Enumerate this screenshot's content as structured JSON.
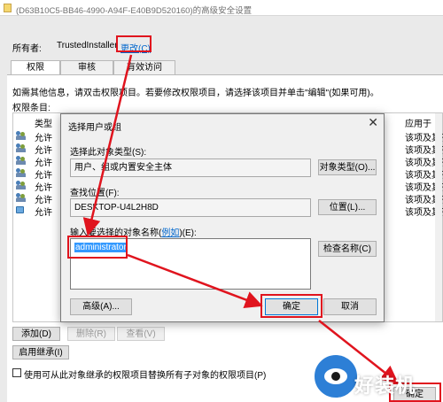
{
  "window": {
    "title": "(D63B10C5-BB46-4990-A94F-E40B9D520160)的高级安全设置"
  },
  "owner": {
    "label": "所有者:",
    "value": "TrustedInstaller",
    "change_link": "更改(C)"
  },
  "tabs": [
    {
      "label": "权限",
      "active": true
    },
    {
      "label": "审核",
      "active": false
    },
    {
      "label": "有效访问",
      "active": false
    }
  ],
  "info_text": "如需其他信息，请双击权限项目。若要修改权限项目，请选择该项目并单击\"编辑\"(如果可用)。",
  "permission_entries_label": "权限条目:",
  "table": {
    "col_type": "类型",
    "col_apply": "应用于",
    "rows": [
      {
        "type": "允许",
        "apply": "该项及其子项",
        "icon": "user-group-icon"
      },
      {
        "type": "允许",
        "apply": "该项及其子项",
        "icon": "user-group-icon"
      },
      {
        "type": "允许",
        "apply": "该项及其子项",
        "icon": "user-group-icon"
      },
      {
        "type": "允许",
        "apply": "该项及其子项",
        "icon": "user-group-icon"
      },
      {
        "type": "允许",
        "apply": "该项及其子项",
        "icon": "user-group-icon"
      },
      {
        "type": "允许",
        "apply": "该项及其子项",
        "icon": "user-group-icon"
      },
      {
        "type": "允许",
        "apply": "该项及其子项",
        "icon": "computer-icon"
      }
    ]
  },
  "buttons": {
    "add": "添加(D)",
    "remove": "删除(R)",
    "view": "查看(V)",
    "enable_inheritance": "启用继承(I)",
    "ok": "确定"
  },
  "checkbox": {
    "label": "使用可从此对象继承的权限项目替换所有子对象的权限项目(P)",
    "checked": false
  },
  "dialog": {
    "title": "选择用户或组",
    "object_type_label": "选择此对象类型(S):",
    "object_type_value": "用户、组或内置安全主体",
    "object_type_button": "对象类型(O)...",
    "location_label": "查找位置(F):",
    "location_value": "DESKTOP-U4L2H8D",
    "location_button": "位置(L)...",
    "name_label_prefix": "输入要选择的对象名称(",
    "name_label_link": "例如",
    "name_label_suffix": ")(E):",
    "name_value": "administrator",
    "check_names_button": "检查名称(C)",
    "advanced_button": "高级(A)...",
    "ok_button": "确定",
    "cancel_button": "取消",
    "close_glyph": "✕"
  },
  "watermark": {
    "text": "好装机"
  },
  "colors": {
    "highlight": "#e0141e",
    "link": "#0066cc",
    "selection": "#3399ff"
  }
}
